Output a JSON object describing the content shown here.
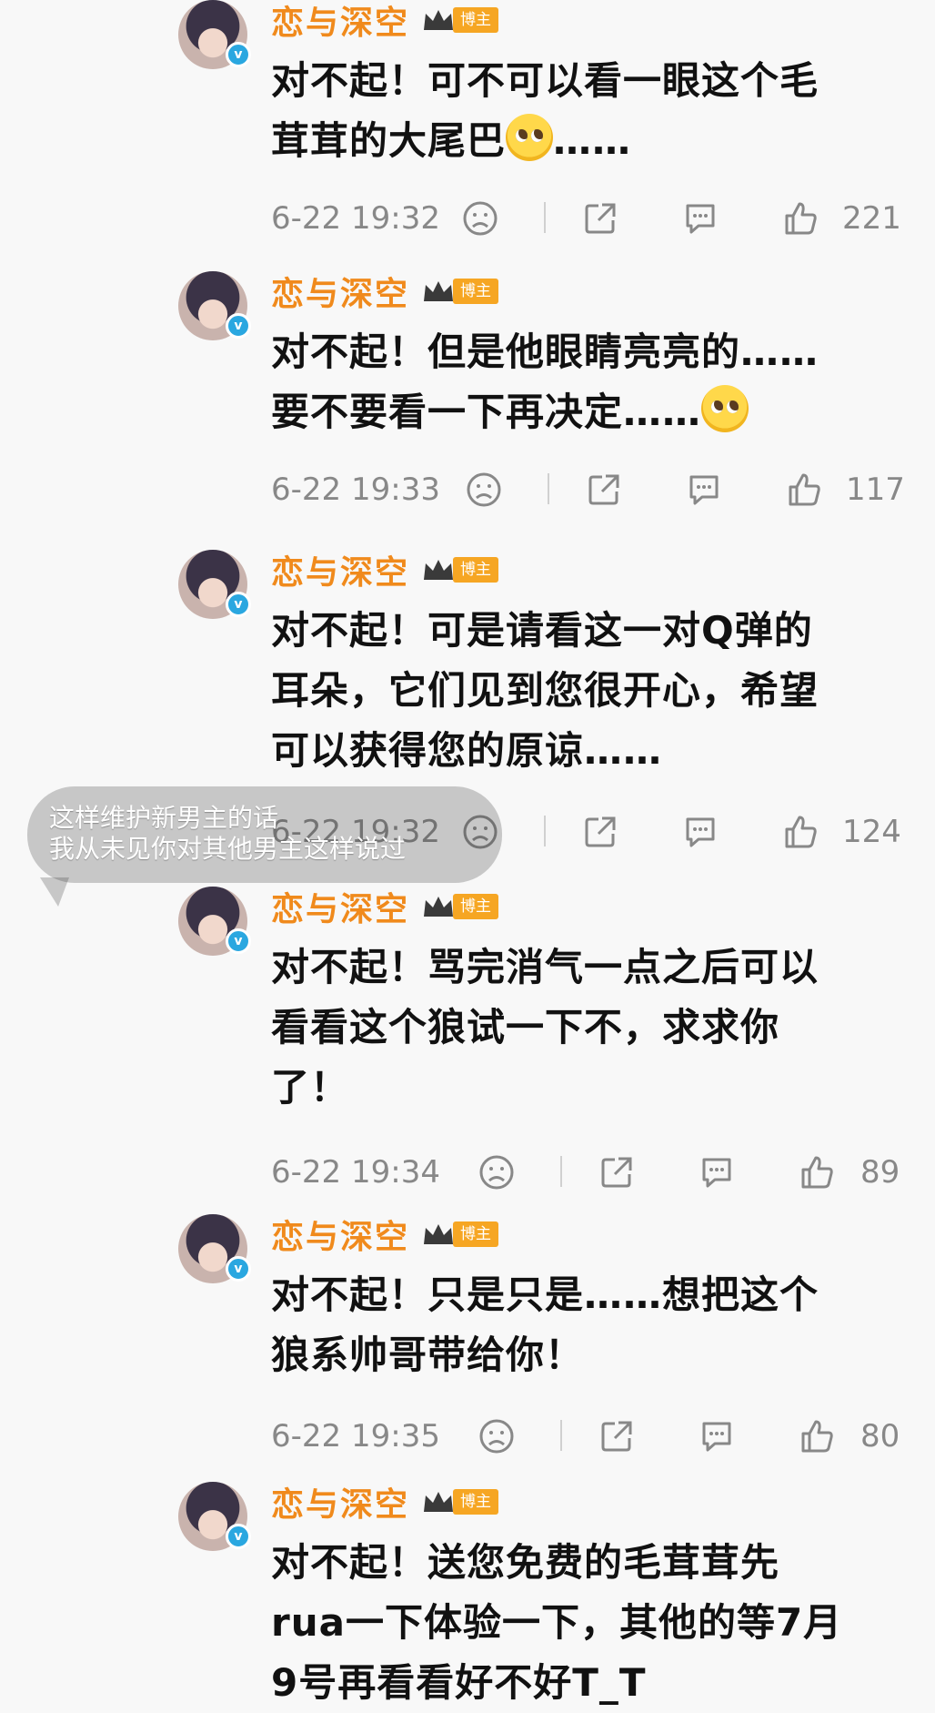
{
  "comments": [
    {
      "author": "恋与深空",
      "badge": "博主",
      "lines": [
        "对不起！可不可以看一眼这个毛",
        "茸茸的大尾巴"
      ],
      "emoji_after": "……",
      "time": "6-22 19:32",
      "likes": "221"
    },
    {
      "author": "恋与深空",
      "badge": "博主",
      "lines": [
        "对不起！但是他眼睛亮亮的……",
        "要不要看一下再决定……"
      ],
      "time": "6-22 19:33",
      "likes": "117"
    },
    {
      "author": "恋与深空",
      "badge": "博主",
      "lines": [
        "对不起！可是请看这一对Q弹的",
        "耳朵，它们见到您很开心，希望",
        "可以获得您的原谅……"
      ],
      "time": "6-22 19:32",
      "likes": "124"
    },
    {
      "author": "恋与深空",
      "badge": "博主",
      "lines": [
        "对不起！骂完消气一点之后可以",
        "看看这个狼试一下不，求求你",
        "了！"
      ],
      "time": "6-22 19:34",
      "likes": "89"
    },
    {
      "author": "恋与深空",
      "badge": "博主",
      "lines": [
        "对不起！只是只是……想把这个",
        "狼系帅哥带给你！"
      ],
      "time": "6-22 19:35",
      "likes": "80"
    },
    {
      "author": "恋与深空",
      "badge": "博主",
      "lines": [
        "对不起！送您免费的毛茸茸先",
        "rua一下体验一下，其他的等7月",
        "9号再看看好不好T_T"
      ]
    }
  ],
  "overlay_bubble": {
    "line1": "这样维护新男主的话",
    "line2": "我从未见你对其他男主这样说过"
  },
  "colors": {
    "author": "#f08a1c",
    "badge": "#f6a623",
    "meta": "#888888",
    "verify": "#2aa7e0"
  },
  "icons": [
    "pleading-emoji",
    "sad-face-icon",
    "share-icon",
    "comment-icon",
    "thumb-up-icon",
    "crown-icon",
    "verified-icon"
  ]
}
